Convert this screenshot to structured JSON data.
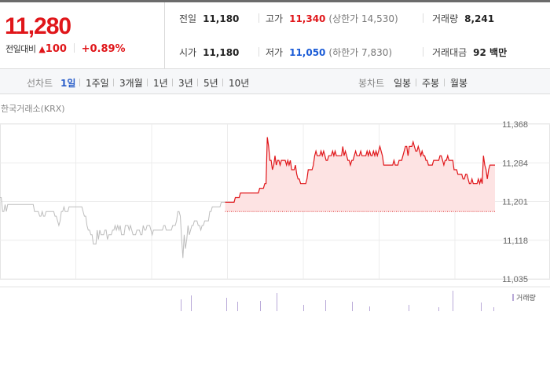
{
  "price": {
    "current": "11,280",
    "change_label": "전일대비",
    "change_arrow": "▲",
    "change_value": "100",
    "change_pct": "+0.89%"
  },
  "stats": {
    "prev_close": {
      "label": "전일",
      "value": "11,180"
    },
    "high": {
      "label": "고가",
      "value": "11,340",
      "note": "(상한가 14,530)"
    },
    "volume": {
      "label": "거래량",
      "value": "8,241"
    },
    "open": {
      "label": "시가",
      "value": "11,180"
    },
    "low": {
      "label": "저가",
      "value": "11,050",
      "note": "(하한가 7,830)"
    },
    "amount": {
      "label": "거래대금",
      "value": "92 백만"
    }
  },
  "toolbar": {
    "line_label": "선차트",
    "line_periods": [
      "1일",
      "1주일",
      "3개월",
      "1년",
      "3년",
      "5년",
      "10년"
    ],
    "active_period": "1일",
    "candle_label": "봉차트",
    "candle_periods": [
      "일봉",
      "주봉",
      "월봉"
    ]
  },
  "source_label": "한국거래소(KRX)",
  "colors": {
    "up": "#e0161a",
    "down": "#1a5bd6",
    "up_fill": "#fde3e3",
    "down_fill": "#dde7f6",
    "neutral": "#bdbdbd",
    "volume": "#b9a9d8"
  },
  "chart_data": {
    "type": "line",
    "baseline": 11180,
    "ylim": [
      11035,
      11368
    ],
    "y_ticks": [
      "11,368",
      "11,284",
      "11,201",
      "11,118",
      "11,035"
    ],
    "series": [
      {
        "values": [
          11210,
          11210,
          11180,
          11180,
          11195,
          11180,
          11195,
          11195,
          11195,
          11195,
          11195,
          11195,
          11195,
          11195,
          11195,
          11195,
          11195,
          11195,
          11195,
          11195,
          11195,
          11195,
          11195,
          11195,
          11195,
          11195,
          11195,
          11180,
          11180,
          11180,
          11180,
          11170,
          11170,
          11180,
          11170,
          11170,
          11180,
          11180,
          11180,
          11180,
          11180,
          11180,
          11180,
          11170,
          11170,
          11160,
          11150,
          11160,
          11180,
          11180,
          11190,
          11180,
          11180,
          11180,
          11190,
          11190,
          11190,
          11190,
          11190,
          11190,
          11190,
          11190,
          11190,
          11190,
          11190,
          11180,
          11170,
          11170,
          11150,
          11140,
          11140,
          11130,
          11130,
          11110,
          11110,
          11110,
          11140,
          11120,
          11140,
          11130,
          11130,
          11130,
          11140,
          11140,
          11120,
          11130,
          11130,
          11130,
          11140,
          11140,
          11150,
          11140,
          11150,
          11140,
          11150,
          11130,
          11130,
          11130,
          11150,
          11150,
          11150,
          11140,
          11150,
          11140,
          11130,
          11130,
          11130,
          11140,
          11140,
          11140,
          11130,
          11130,
          11150,
          11140,
          11140,
          11150,
          11150,
          11150,
          11140,
          11130,
          11140,
          11140,
          11140,
          11140,
          11140,
          11140,
          11140,
          11140,
          11150,
          11150,
          11140,
          11140,
          11140,
          11140,
          11140,
          11150,
          11150,
          11150,
          11160,
          11180,
          11180,
          11170,
          11120,
          11080,
          11130,
          11100,
          11120,
          11150,
          11130,
          11140,
          11150,
          11150,
          11160,
          11160,
          11160,
          11150,
          11150,
          11140,
          11150,
          11150,
          11160,
          11160,
          11160,
          11160,
          11180,
          11180,
          11190,
          11190,
          11190,
          11190,
          11190,
          11190,
          11190,
          11200,
          11200,
          11200,
          11200,
          11200,
          11200,
          11200,
          11200,
          11200,
          11200,
          11200,
          11210,
          11210,
          11210,
          11210,
          11220,
          11220,
          11220,
          11220,
          11220,
          11220,
          11220,
          11220,
          11220,
          11220,
          11220,
          11220,
          11220,
          11220,
          11220,
          11230,
          11230,
          11230,
          11230,
          11240,
          11240,
          11340,
          11320,
          11290,
          11290,
          11270,
          11280,
          11300,
          11280,
          11290,
          11290,
          11280,
          11290,
          11290,
          11290,
          11290,
          11280,
          11290,
          11280,
          11290,
          11270,
          11270,
          11270,
          11280,
          11260,
          11250,
          11250,
          11240,
          11240,
          11240,
          11240,
          11240,
          11250,
          11270,
          11270,
          11270,
          11270,
          11280,
          11300,
          11310,
          11300,
          11300,
          11300,
          11310,
          11300,
          11310,
          11300,
          11290,
          11290,
          11300,
          11300,
          11300,
          11310,
          11300,
          11310,
          11300,
          11300,
          11300,
          11300,
          11300,
          11320,
          11300,
          11310,
          11300,
          11290,
          11290,
          11280,
          11290,
          11290,
          11300,
          11310,
          11300,
          11300,
          11300,
          11310,
          11300,
          11300,
          11300,
          11300,
          11310,
          11300,
          11310,
          11300,
          11300,
          11310,
          11300,
          11310,
          11300,
          11310,
          11320,
          11310,
          11300,
          11280,
          11280,
          11280,
          11280,
          11280,
          11280,
          11280,
          11280,
          11290,
          11280,
          11280,
          11280,
          11290,
          11290,
          11290,
          11300,
          11310,
          11320,
          11320,
          11300,
          11320,
          11320,
          11320,
          11330,
          11320,
          11310,
          11310,
          11320,
          11310,
          11300,
          11310,
          11300,
          11300,
          11290,
          11290,
          11280,
          11280,
          11280,
          11280,
          11290,
          11290,
          11290,
          11290,
          11290,
          11300,
          11300,
          11290,
          11280,
          11290,
          11290,
          11300,
          11290,
          11290,
          11290,
          11290,
          11270,
          11270,
          11270,
          11260,
          11260,
          11260,
          11260,
          11250,
          11250,
          11260,
          11260,
          11250,
          11240,
          11240,
          11250,
          11240,
          11240,
          11240,
          11240,
          11250,
          11240,
          11250,
          11240,
          11300,
          11280,
          11270,
          11250,
          11270,
          11280,
          11280,
          11280,
          11280,
          11280
        ]
      }
    ],
    "volume_label": "거래량"
  }
}
